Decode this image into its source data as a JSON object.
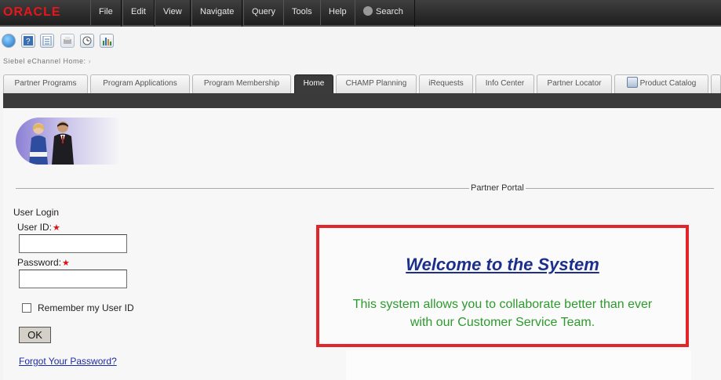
{
  "header": {
    "logo": "ORACLE",
    "menu": [
      "File",
      "Edit",
      "View",
      "Navigate",
      "Query",
      "Tools",
      "Help"
    ],
    "search_label": "Search"
  },
  "toolbar": {
    "icons": [
      "globe-icon",
      "help-icon",
      "checklist-icon",
      "print-icon",
      "clock-icon",
      "chart-icon"
    ]
  },
  "breadcrumb": "Siebel eChannel Home:",
  "tabs": [
    {
      "label": "Partner Programs",
      "active": false
    },
    {
      "label": "Program Applications",
      "active": false
    },
    {
      "label": "Program Membership",
      "active": false
    },
    {
      "label": "Home",
      "active": true
    },
    {
      "label": "CHAMP Planning",
      "active": false
    },
    {
      "label": "iRequests",
      "active": false
    },
    {
      "label": "Info Center",
      "active": false
    },
    {
      "label": "Partner Locator",
      "active": false
    },
    {
      "label": "Product Catalog",
      "active": false
    }
  ],
  "portal": {
    "section_title": "Partner Portal",
    "login_title": "User Login",
    "user_id_label": "User ID:",
    "password_label": "Password:",
    "required_mark": "★",
    "user_id_value": "",
    "password_value": "",
    "remember_label": "Remember my User ID",
    "ok_label": "OK",
    "forgot_label": "Forgot Your Password?"
  },
  "welcome": {
    "title": "Welcome to the System",
    "line1": "This system allows you to collaborate better than ever",
    "line2": "with our Customer Service Team."
  },
  "colors": {
    "accent_red": "#e2242b",
    "welcome_title": "#1c2f8c",
    "welcome_text": "#2c9a2c"
  }
}
